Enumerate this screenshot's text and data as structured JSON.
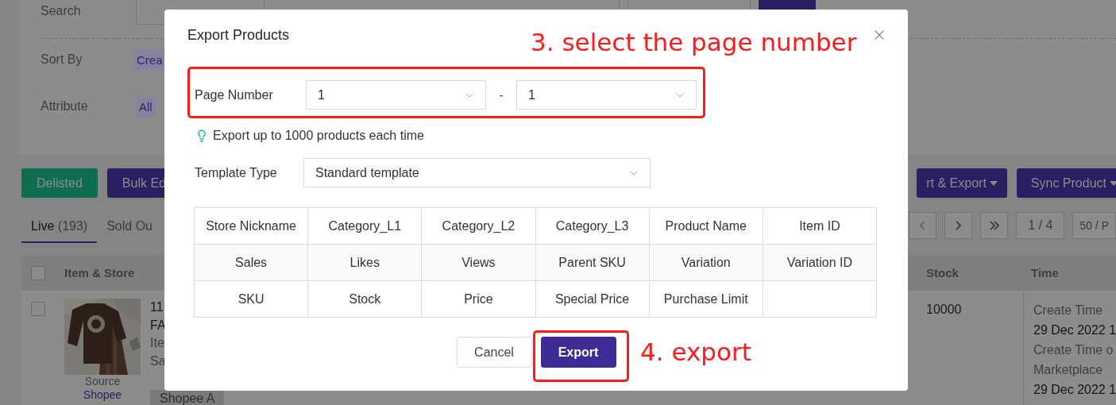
{
  "filters": {
    "search": {
      "label": "Search"
    },
    "sort_by": {
      "label": "Sort By",
      "chips": [
        {
          "label": "Crea",
          "selected": true
        }
      ]
    },
    "attribute": {
      "label": "Attribute",
      "chips": [
        {
          "label": "All",
          "selected": true
        }
      ]
    }
  },
  "left_actions": [
    {
      "label": "Delisted",
      "kind": "success"
    },
    {
      "label": "Bulk Ed",
      "kind": "primary"
    }
  ],
  "right_actions": [
    {
      "label": "rt & Export",
      "kind": "dropdown"
    },
    {
      "label": "Sync Product",
      "kind": "dropdown"
    }
  ],
  "tabs": [
    {
      "label": "Live",
      "count": "(193)",
      "selected": true
    },
    {
      "label": "Sold Ou",
      "selected": false
    }
  ],
  "pagination": {
    "page": "1 / 4",
    "page_size": "50 / P"
  },
  "table": {
    "select_all": {
      "checked": false
    },
    "columns": [
      "Item & Store",
      "Stock",
      "Time"
    ],
    "rows": [
      {
        "checked": false,
        "item_lines": [
          "11",
          "FA",
          "Ite",
          "Sa"
        ],
        "source_label": "Source",
        "source": "Shopee",
        "store": "Shopee A",
        "stock": "10000",
        "time_lines": [
          {
            "kind": "label",
            "text": "Create Time"
          },
          {
            "kind": "value",
            "text": "29 Dec 2022 1"
          },
          {
            "kind": "label",
            "text": "Create Time o"
          },
          {
            "kind": "label",
            "text": "Marketplace"
          },
          {
            "kind": "value",
            "text": "29 Dec 2022 1"
          }
        ]
      }
    ]
  },
  "modal": {
    "title": "Export Products",
    "page_number": {
      "label": "Page Number",
      "from": "1",
      "separator": "-",
      "to": "1"
    },
    "hint": "Export up to 1000 products each time",
    "template": {
      "label": "Template Type",
      "value": "Standard template"
    },
    "fields": [
      "Store Nickname",
      "Category_L1",
      "Category_L2",
      "Category_L3",
      "Product Name",
      "Item ID",
      "Sales",
      "Likes",
      "Views",
      "Parent SKU",
      "Variation",
      "Variation ID",
      "SKU",
      "Stock",
      "Price",
      "Special Price",
      "Purchase Limit"
    ],
    "buttons": [
      {
        "label": "Cancel",
        "kind": "default"
      },
      {
        "label": "Export",
        "kind": "primary"
      }
    ]
  },
  "annotations": [
    {
      "kind": "page-range",
      "text": "3. select the page number"
    },
    {
      "kind": "export",
      "text": "4. export"
    }
  ]
}
